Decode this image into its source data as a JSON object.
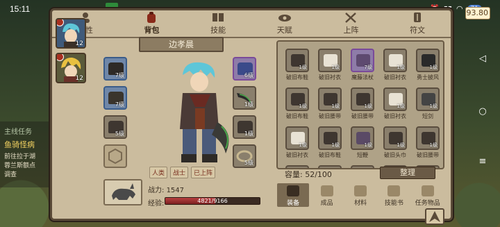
{
  "status_bar": {
    "time": "15:11",
    "battery": "71",
    "coins": "93.80"
  },
  "quest": {
    "title": "主线任务",
    "name": "鱼骑怪病",
    "lines": [
      "前往拉于湖",
      "蓉兰斯额点",
      "调查"
    ]
  },
  "tabs": [
    {
      "label": "属性",
      "icon": "person-icon"
    },
    {
      "label": "背包",
      "icon": "backpack-icon"
    },
    {
      "label": "技能",
      "icon": "book-icon"
    },
    {
      "label": "天赋",
      "icon": "eye-icon"
    },
    {
      "label": "上阵",
      "icon": "crossed-swords-icon"
    },
    {
      "label": "符文",
      "icon": "rune-icon"
    }
  ],
  "roster": [
    {
      "level": "12",
      "hair": "#5ec6d8"
    },
    {
      "level": "12",
      "hair": "#e8c040"
    }
  ],
  "character": {
    "name": "边孝晨",
    "tags": [
      "人类",
      "战士",
      "已上阵"
    ],
    "power_label": "战力:",
    "power_value": "1547",
    "xp_label": "经验:",
    "xp_current": 4821,
    "xp_max": 9166,
    "xp_text": "4821/9166"
  },
  "equipment_left": [
    {
      "level": "7级",
      "rarity": "blue"
    },
    {
      "level": "7级",
      "rarity": "blue"
    },
    {
      "level": "5级",
      "rarity": "normal"
    },
    {
      "level": "",
      "rarity": "empty"
    }
  ],
  "equipment_right": [
    {
      "level": "6级",
      "rarity": "purple"
    },
    {
      "level": "1级",
      "rarity": "normal"
    },
    {
      "level": "1级",
      "rarity": "normal"
    },
    {
      "level": "5级",
      "rarity": "normal"
    }
  ],
  "inventory": {
    "items": [
      {
        "name": "破旧布鞋",
        "level": "1级",
        "rarity": "normal",
        "color": "#3e3630"
      },
      {
        "name": "破旧衬衣",
        "level": "1级",
        "rarity": "normal",
        "color": "#e8e2d4"
      },
      {
        "name": "魔藤法杖",
        "level": "7级",
        "rarity": "purple",
        "color": "#5e4a70"
      },
      {
        "name": "破旧衬衣",
        "level": "1级",
        "rarity": "normal",
        "color": "#e8e2d4"
      },
      {
        "name": "勇士披风",
        "level": "1级",
        "rarity": "normal",
        "color": "#2a2a2a"
      },
      {
        "name": "破旧布鞋",
        "level": "1级",
        "rarity": "normal",
        "color": "#3e3630"
      },
      {
        "name": "破旧腰带",
        "level": "1级",
        "rarity": "normal",
        "color": "#3e3630"
      },
      {
        "name": "破旧腰带",
        "level": "1级",
        "rarity": "normal",
        "color": "#3e3630"
      },
      {
        "name": "破旧衬衣",
        "level": "1级",
        "rarity": "normal",
        "color": "#e8e2d4"
      },
      {
        "name": "短剑",
        "level": "1级",
        "rarity": "normal",
        "color": "#444444"
      },
      {
        "name": "破旧衬衣",
        "level": "1级",
        "rarity": "normal",
        "color": "#e8e2d4"
      },
      {
        "name": "破旧布鞋",
        "level": "1级",
        "rarity": "normal",
        "color": "#3e3630"
      },
      {
        "name": "短鞭",
        "level": "1级",
        "rarity": "normal",
        "color": "#5a4a66"
      },
      {
        "name": "破旧头巾",
        "level": "1级",
        "rarity": "normal",
        "color": "#3e3630"
      },
      {
        "name": "破旧腰带",
        "level": "1级",
        "rarity": "normal",
        "color": "#3e3630"
      },
      {
        "name": "",
        "level": "",
        "rarity": "normal",
        "color": "#3e3630"
      },
      {
        "name": "",
        "level": "",
        "rarity": "normal",
        "color": "#5a4a3a"
      },
      {
        "name": "",
        "level": "",
        "rarity": "normal",
        "color": "#3e3630"
      },
      {
        "name": "",
        "level": "",
        "rarity": "normal",
        "color": "#5a4a66"
      },
      {
        "name": "",
        "level": "",
        "rarity": "normal",
        "color": "#3e3630"
      }
    ],
    "capacity": "容量: 52/100",
    "arrange_label": "整理",
    "categories": [
      "装备",
      "成品",
      "材料",
      "技能书",
      "任务物品"
    ]
  }
}
